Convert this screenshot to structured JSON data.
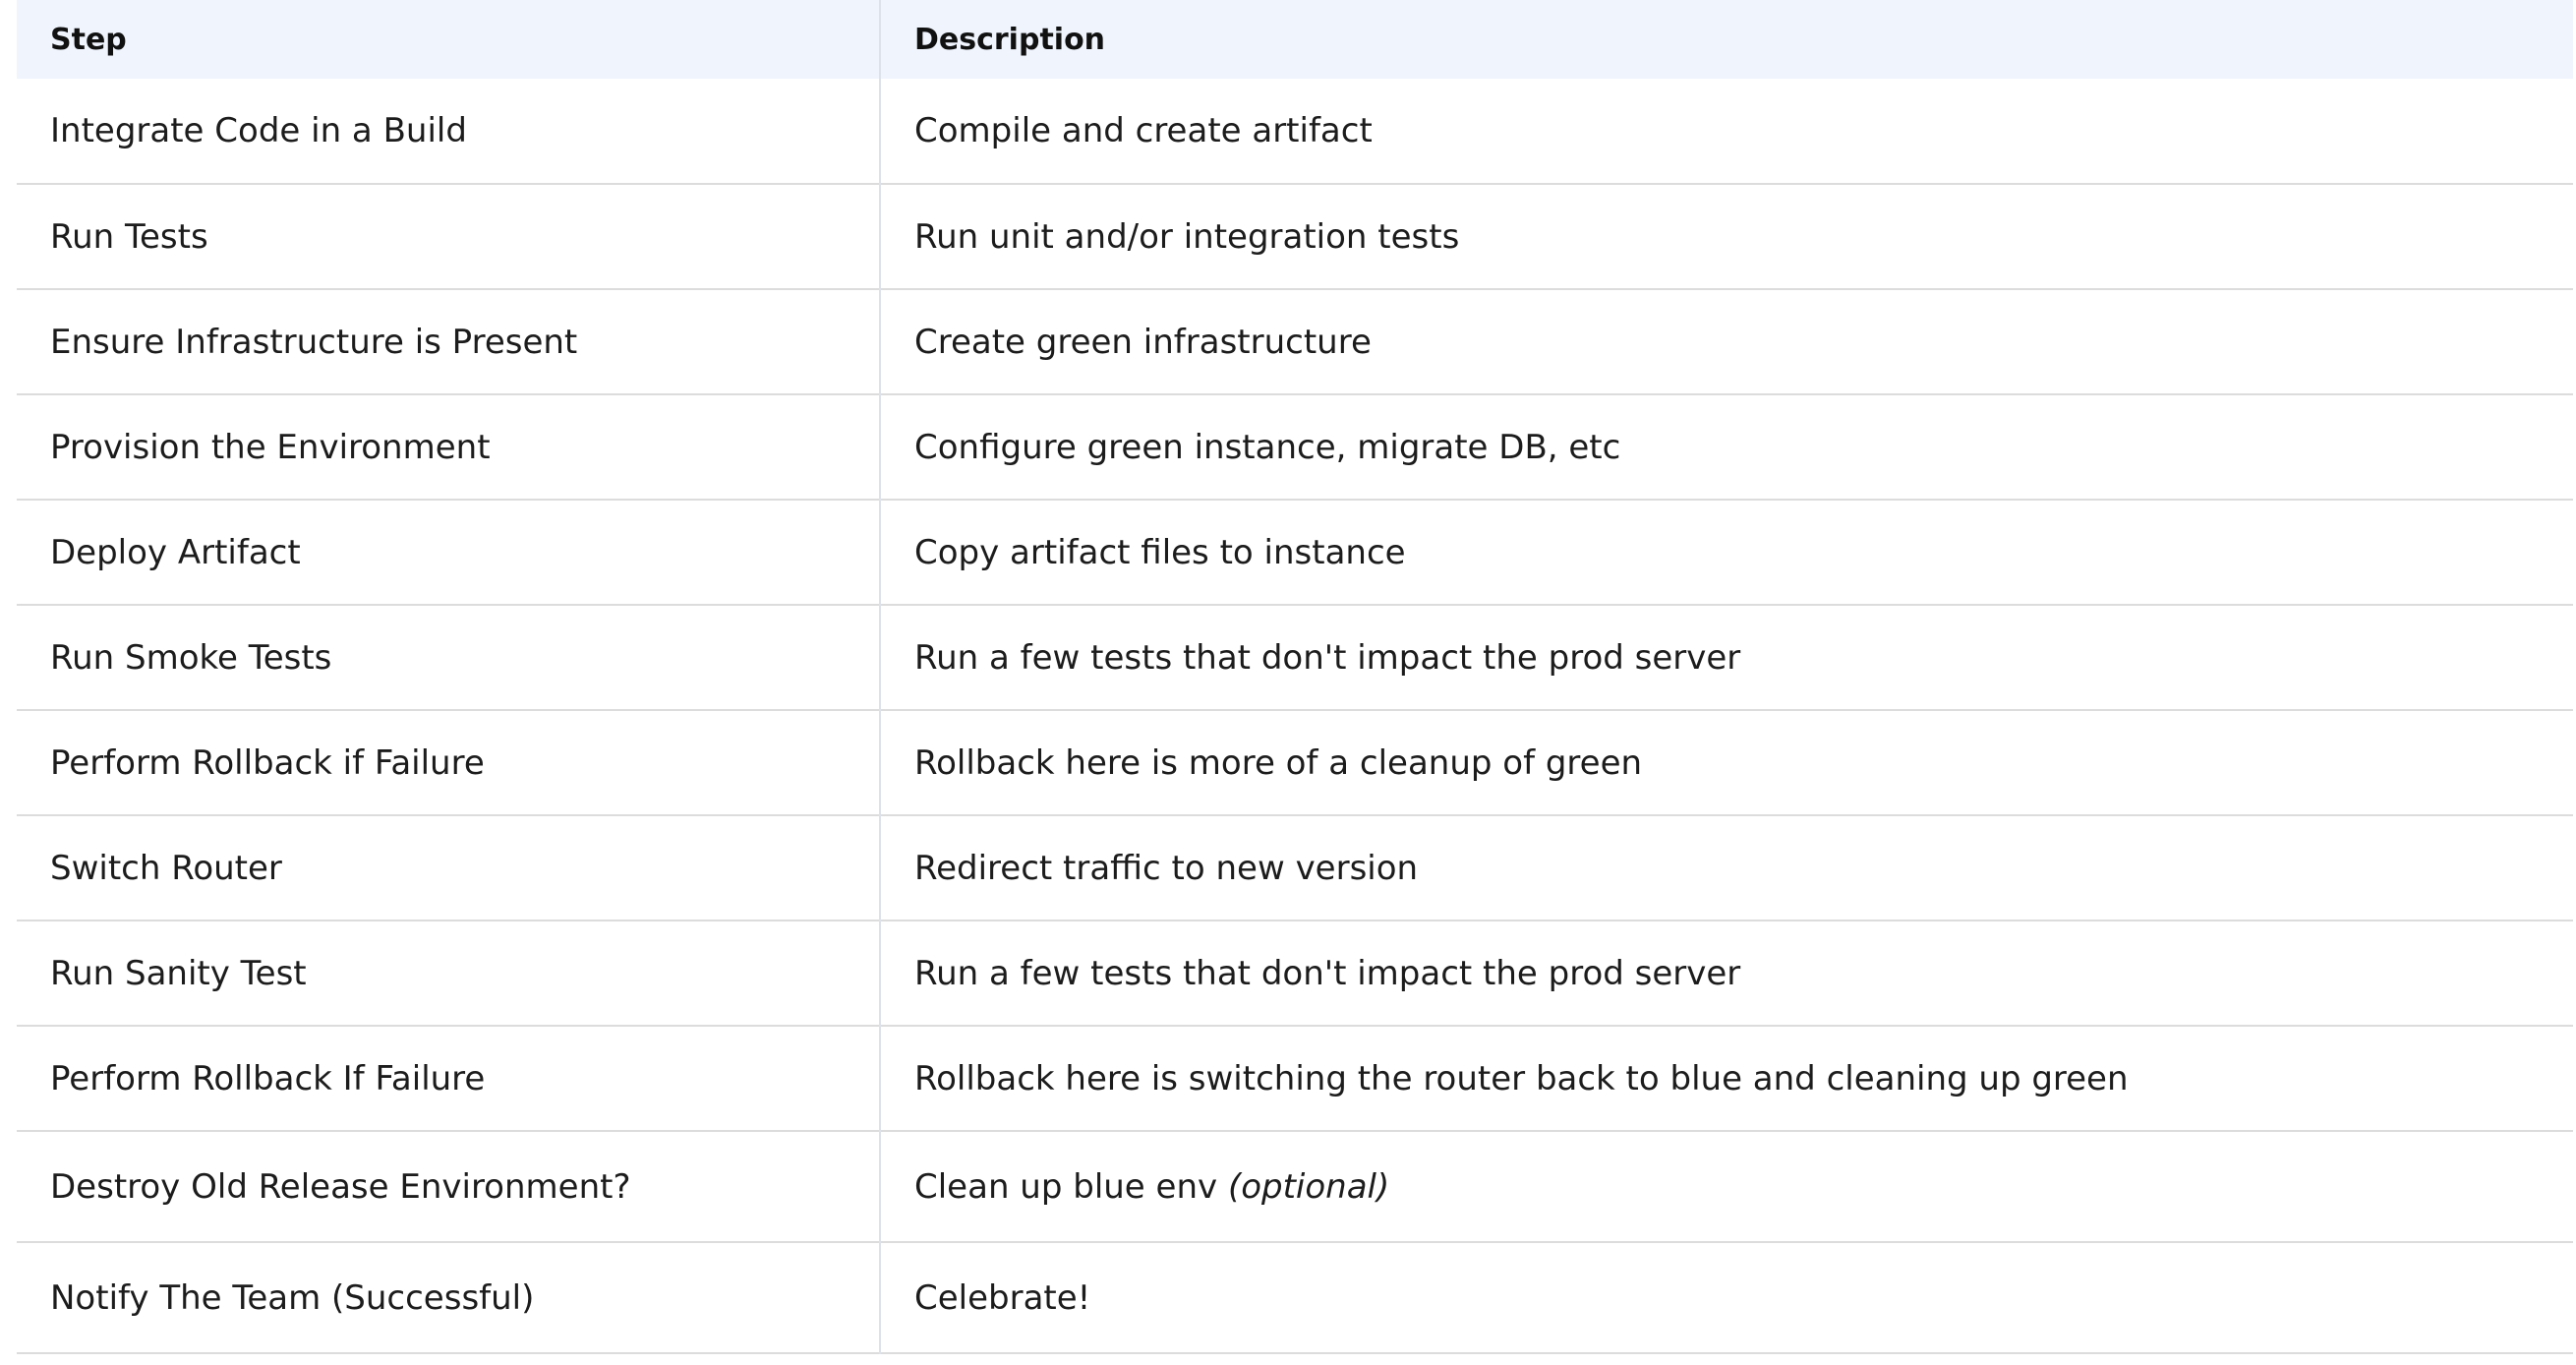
{
  "table": {
    "headers": {
      "step": "Step",
      "description": "Description"
    },
    "rows": [
      {
        "step": "Integrate Code in a Build",
        "description": "Compile and create artifact",
        "note": ""
      },
      {
        "step": "Run Tests",
        "description": "Run unit and/or integration tests",
        "note": ""
      },
      {
        "step": "Ensure Infrastructure is Present",
        "description": "Create green infrastructure",
        "note": ""
      },
      {
        "step": "Provision the Environment",
        "description": "Configure green instance, migrate DB, etc",
        "note": ""
      },
      {
        "step": "Deploy Artifact",
        "description": "Copy artifact files to instance",
        "note": ""
      },
      {
        "step": "Run Smoke Tests",
        "description": "Run a few tests that don't impact the prod server",
        "note": ""
      },
      {
        "step": "Perform Rollback if Failure",
        "description": "Rollback here is more of a cleanup of green",
        "note": ""
      },
      {
        "step": "Switch Router",
        "description": "Redirect traffic to new version",
        "note": ""
      },
      {
        "step": "Run Sanity Test",
        "description": "Run a few tests that don't impact the prod server",
        "note": ""
      },
      {
        "step": "Perform Rollback If Failure",
        "description": "Rollback here is switching the router back to blue and cleaning up green",
        "note": ""
      },
      {
        "step": "Destroy Old Release Environment?",
        "description": "Clean up blue env ",
        "note": "(optional)"
      },
      {
        "step": "Notify The Team (Successful)",
        "description": "Celebrate!",
        "note": ""
      }
    ]
  }
}
